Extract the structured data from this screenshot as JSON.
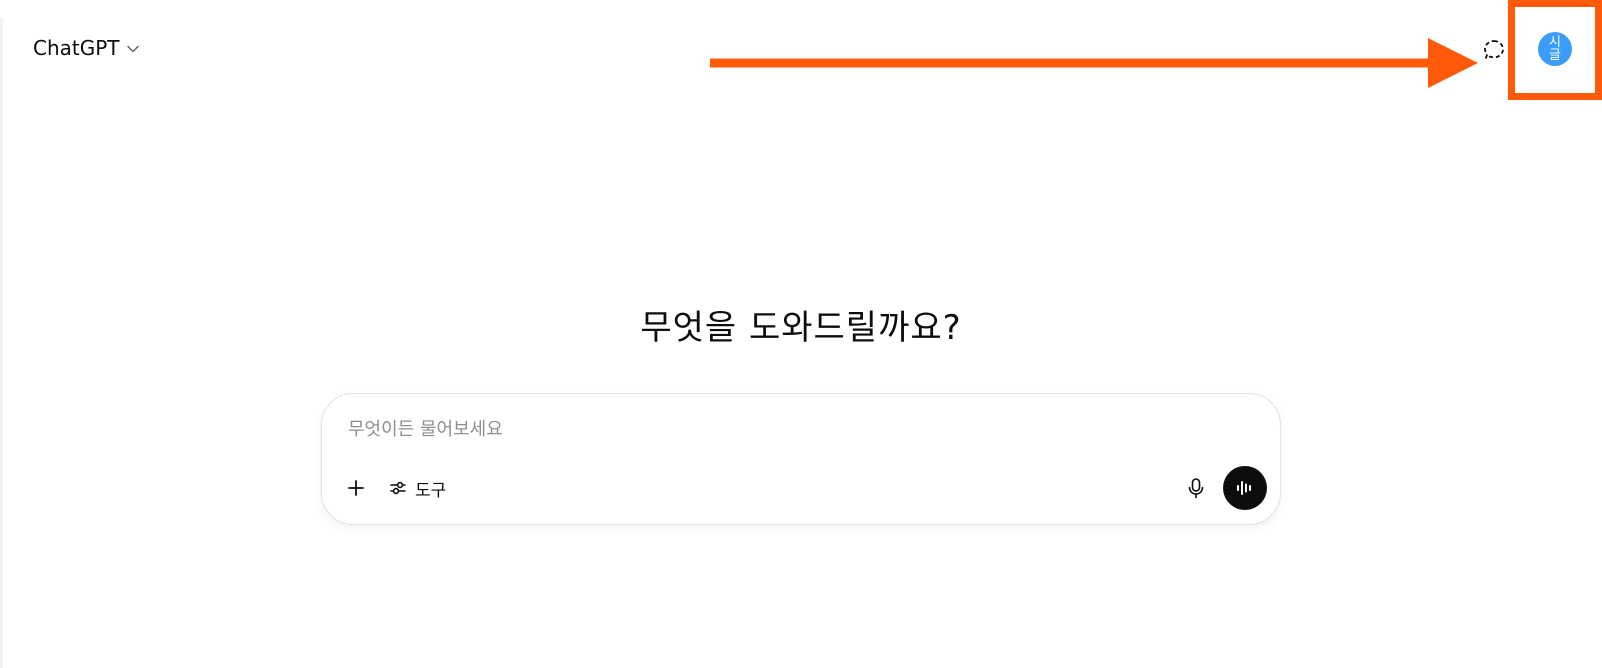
{
  "header": {
    "model_name": "ChatGPT",
    "model_dropdown_icon": "chevron-down-icon",
    "temporary_chat_icon": "dashed-chat-bubble-icon",
    "avatar_text": "시글"
  },
  "annotation": {
    "arrow_color": "#ff5a0a",
    "highlight_color": "#ff5a0a"
  },
  "main": {
    "heading": "무엇을 도와드릴까요?",
    "composer": {
      "placeholder": "무엇이든 물어보세요",
      "value": "",
      "add_icon": "plus-icon",
      "tools_icon": "sliders-icon",
      "tools_label": "도구",
      "mic_icon": "microphone-icon",
      "voice_icon": "voice-waveform-icon"
    }
  },
  "colors": {
    "avatar_bg": "#3b9dfa",
    "voice_button_bg": "#0d0d0d",
    "text": "#0d0d0d",
    "placeholder": "#8f8f8f"
  }
}
